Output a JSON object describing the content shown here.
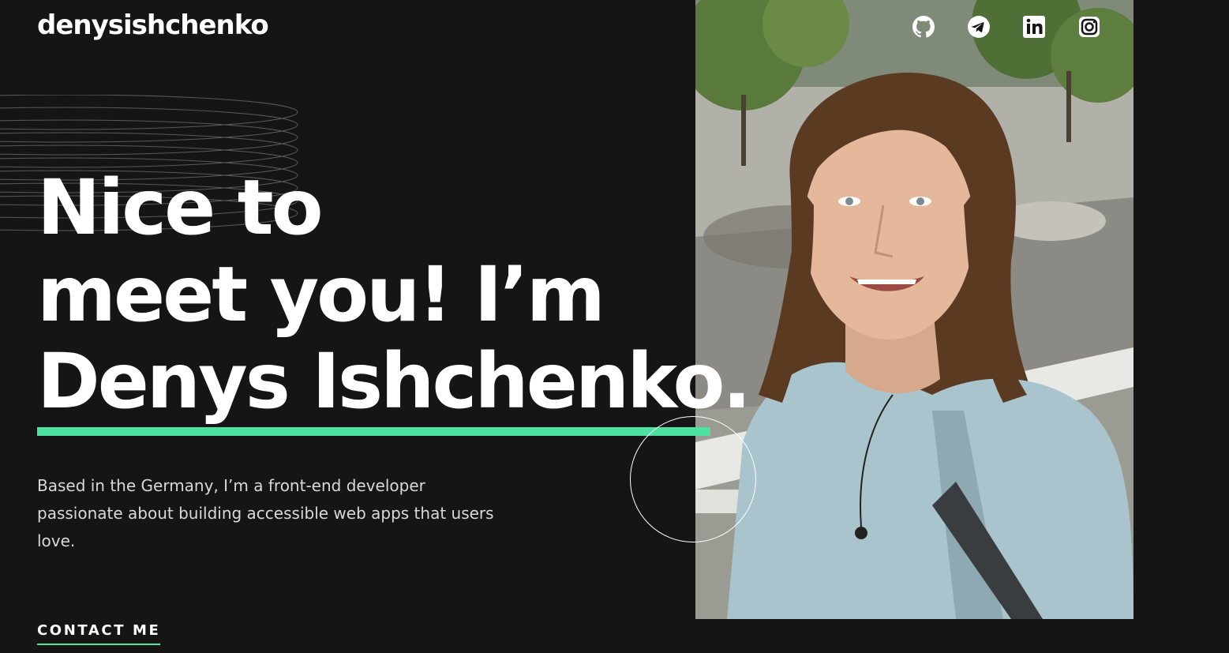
{
  "brand": {
    "logo_text": "denysishchenko",
    "accent_color": "#4ee1a0",
    "background_color": "#151515"
  },
  "socials": [
    {
      "name": "GitHub",
      "icon": "github-icon"
    },
    {
      "name": "Telegram",
      "icon": "telegram-icon"
    },
    {
      "name": "LinkedIn",
      "icon": "linkedin-icon"
    },
    {
      "name": "Instagram",
      "icon": "instagram-icon"
    }
  ],
  "hero": {
    "headline_line_1": "Nice to",
    "headline_line_2": "meet you! I’m",
    "headline_line_3": "Denys Ishchenko.",
    "intro": "Based in the Germany, I’m a front-end developer passionate about building accessible web apps that users love.",
    "contact_label": "CONTACT ME",
    "photo_icon": "profile-photo"
  }
}
